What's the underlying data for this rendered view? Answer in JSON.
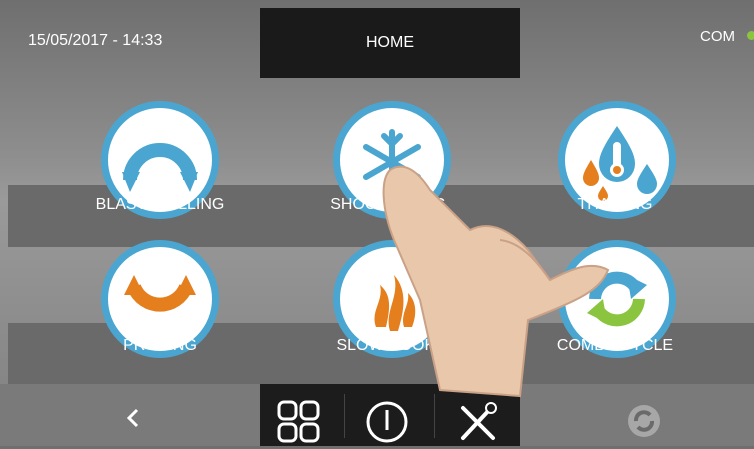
{
  "header": {
    "datetime": "15/05/2017 - 14:33",
    "title": "HOME",
    "status": "COM"
  },
  "programs": [
    {
      "label": "BLAST CHILLING",
      "icon": "blast-chilling-icon"
    },
    {
      "label": "SHOCK FREEZING",
      "icon": "snowflake-icon",
      "visible_label": "SHOCK R        ZING"
    },
    {
      "label": "THAWING",
      "icon": "thawing-drops-icon"
    },
    {
      "label": "PROVING",
      "icon": "proving-icon"
    },
    {
      "label": "SLOW COOKI",
      "icon": "flame-icon"
    },
    {
      "label": "COMBY CYCLE",
      "icon": "comby-cycle-icon"
    }
  ],
  "nav": {
    "back": "back-chevron-icon",
    "menu": "grid-icon",
    "power": "power-icon",
    "tools": "tools-icon",
    "cycle": "cycle-icon"
  },
  "colors": {
    "accent": "#4aa6d0",
    "orange": "#e57f1e",
    "green": "#8bc53f",
    "dark": "#1a1a1a"
  }
}
